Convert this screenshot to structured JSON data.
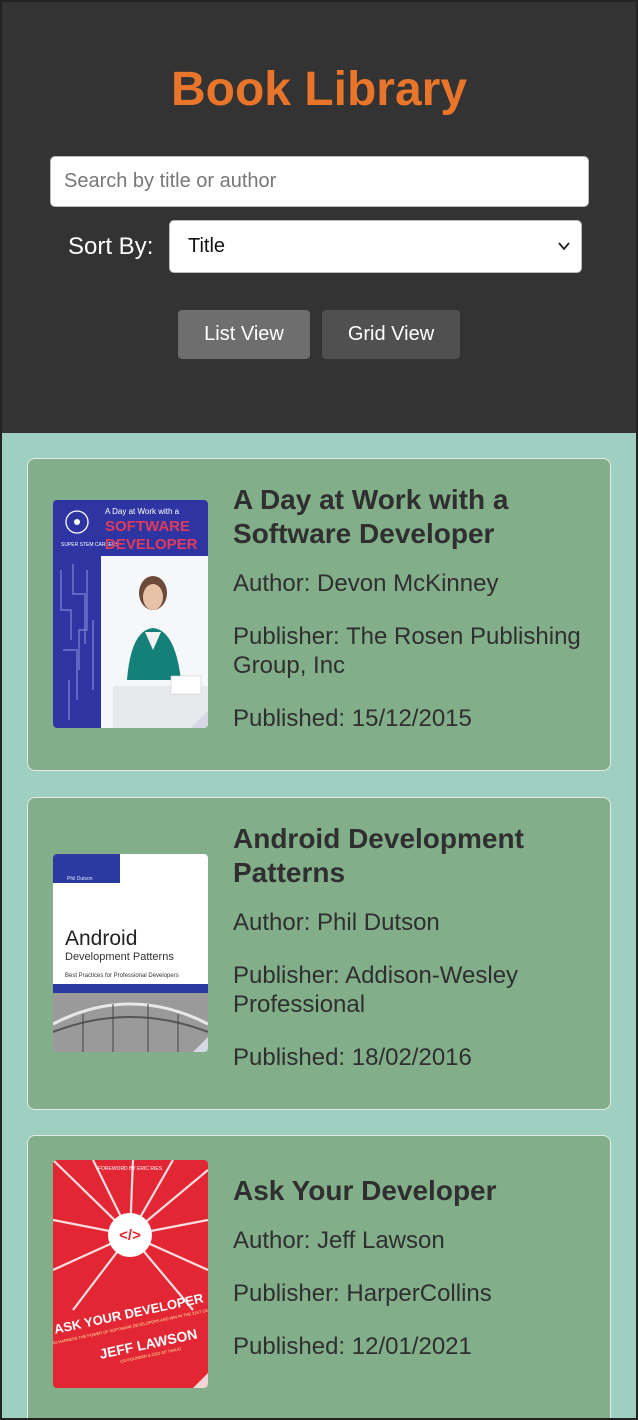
{
  "app": {
    "title": "Book Library"
  },
  "search": {
    "placeholder": "Search by title or author",
    "value": ""
  },
  "sort": {
    "label": "Sort By:",
    "selected": "Title"
  },
  "view_toggle": {
    "list_label": "List View",
    "grid_label": "Grid View"
  },
  "books": [
    {
      "title": "A Day at Work with a Software Developer",
      "author": "Author: Devon McKinney",
      "publisher": "Publisher: The Rosen Publishing Group, Inc",
      "published": "Published: 15/12/2015",
      "cover": {
        "header_line": "A Day at Work with a",
        "title_line1": "SOFTWARE",
        "title_line2": "DEVELOPER",
        "side_text": "SUPER STEM CAREERS",
        "color": "#2e35a3",
        "accent": "#e23a5a"
      }
    },
    {
      "title": "Android Development Patterns",
      "author": "Author: Phil Dutson",
      "publisher": "Publisher: Addison-Wesley Professional",
      "published": "Published: 18/02/2016",
      "cover": {
        "author_line": "Phil Dutson",
        "title_line1": "Android",
        "title_line2": "Development Patterns",
        "subtitle": "Best Practices for Professional Developers",
        "color": "#2b3aa0"
      }
    },
    {
      "title": "Ask Your Developer",
      "author": "Author: Jeff Lawson",
      "publisher": "Publisher: HarperCollins",
      "published": "Published: 12/01/2021",
      "cover": {
        "top_line": "FOREWORD BY ERIC RIES",
        "code_symbol": "</>",
        "title_line": "ASK YOUR DEVELOPER",
        "subtitle": "HOW TO HARNESS THE POWER OF SOFTWARE DEVELOPERS AND WIN IN THE 21ST CENTURY",
        "author_line": "JEFF LAWSON",
        "author_sub": "CO-FOUNDER & CEO OF TWILIO",
        "color": "#e32633"
      }
    }
  ]
}
